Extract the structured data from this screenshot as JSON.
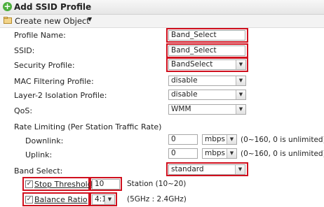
{
  "window": {
    "title": "Add SSID Profile"
  },
  "toolbar": {
    "create_label": "Create new Object"
  },
  "form": {
    "profile_name": {
      "label": "Profile Name:",
      "value": "Band_Select"
    },
    "ssid": {
      "label": "SSID:",
      "value": "Band_Select"
    },
    "security_profile": {
      "label": "Security Profile:",
      "value": "BandSelect"
    },
    "mac_filtering": {
      "label": "MAC Filtering Profile:",
      "value": "disable"
    },
    "layer2_isolation": {
      "label": "Layer-2 Isolation Profile:",
      "value": "disable"
    },
    "qos": {
      "label": "QoS:",
      "value": "WMM"
    },
    "rate_limiting": {
      "label": "Rate Limiting (Per Station Traffic Rate)",
      "downlink": {
        "label": "Downlink:",
        "value": "0",
        "unit": "mbps",
        "hint": "(0~160, 0 is unlimited)"
      },
      "uplink": {
        "label": "Uplink:",
        "value": "0",
        "unit": "mbps",
        "hint": "(0~160, 0 is unlimited)"
      }
    },
    "band_select": {
      "label": "Band Select:",
      "value": "standard"
    },
    "stop_threshold": {
      "label": "Stop Threshold",
      "checked": true,
      "value": "10",
      "hint": "Station (10~20)"
    },
    "balance_ratio": {
      "label": "Balance Ratio",
      "checked": true,
      "value": "4:1",
      "hint": "(5GHz : 2.4GHz)"
    }
  },
  "colors": {
    "highlight": "#d0101e",
    "title_icon": "#4cae3c"
  }
}
